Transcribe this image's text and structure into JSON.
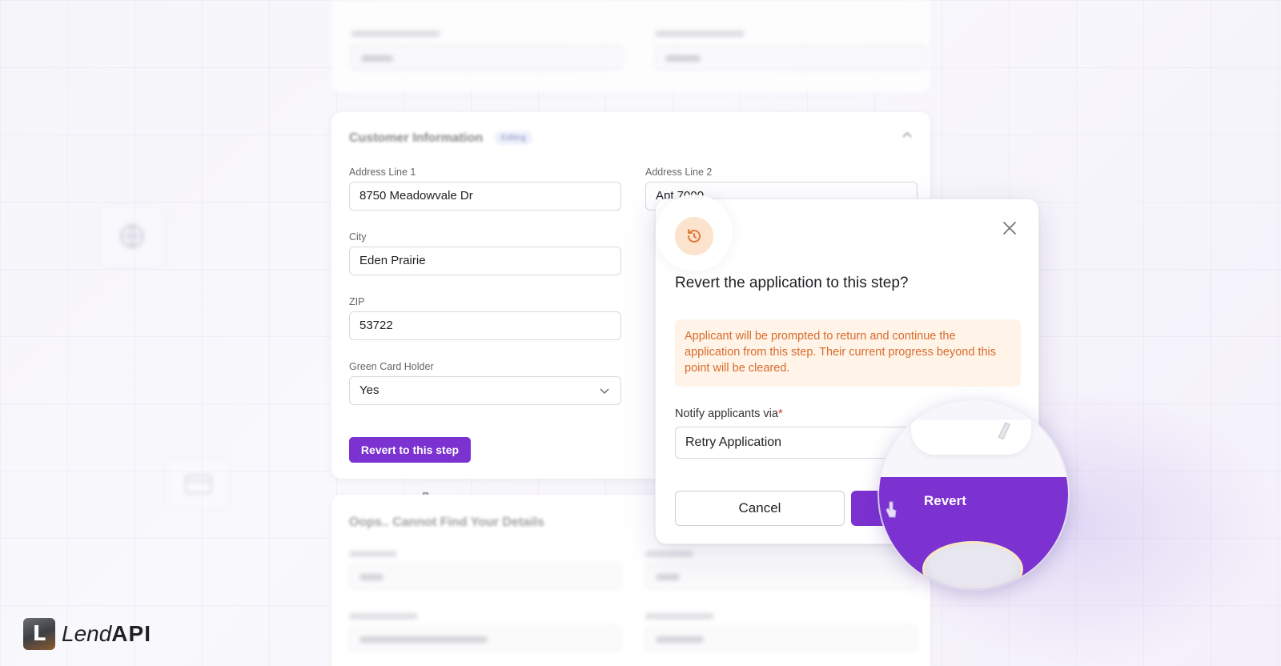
{
  "customer_card": {
    "title": "Customer Information",
    "tag": "Editing",
    "fields": {
      "address_line_1": {
        "label": "Address Line 1",
        "value": "8750 Meadowvale Dr"
      },
      "address_line_2": {
        "label": "Address Line 2",
        "value": "Apt 7000"
      },
      "city": {
        "label": "City",
        "value": "Eden Prairie"
      },
      "zip": {
        "label": "ZIP",
        "value": "53722"
      },
      "green_card": {
        "label": "Green Card Holder",
        "value": "Yes"
      }
    },
    "revert_step_label": "Revert to this step"
  },
  "bottom_card": {
    "title": "Oops.. Cannot Find Your Details"
  },
  "modal": {
    "title": "Revert the application to this step?",
    "alert": "Applicant will be prompted to return and continue the application from this step. Their current progress beyond this point will be cleared.",
    "notify_label": "Notify applicants via",
    "notify_required": "*",
    "notify_value": "Retry Application",
    "cancel_label": "Cancel",
    "revert_label": "Revert"
  },
  "magnifier": {
    "revert_label": "Revert"
  },
  "logo": {
    "mark": "L",
    "text_light": "Lend",
    "text_bold": "API"
  },
  "colors": {
    "primary": "#7b32d1",
    "alert_bg": "#fff4e7",
    "alert_text": "#d76b2f",
    "icon_bg": "#fbe3cd",
    "icon_fg": "#e07a3a"
  },
  "icons": {
    "modal_icon": "revert-icon",
    "close": "close-icon",
    "chevron": "chevron-down-icon",
    "cursor": "hand-cursor-icon"
  }
}
